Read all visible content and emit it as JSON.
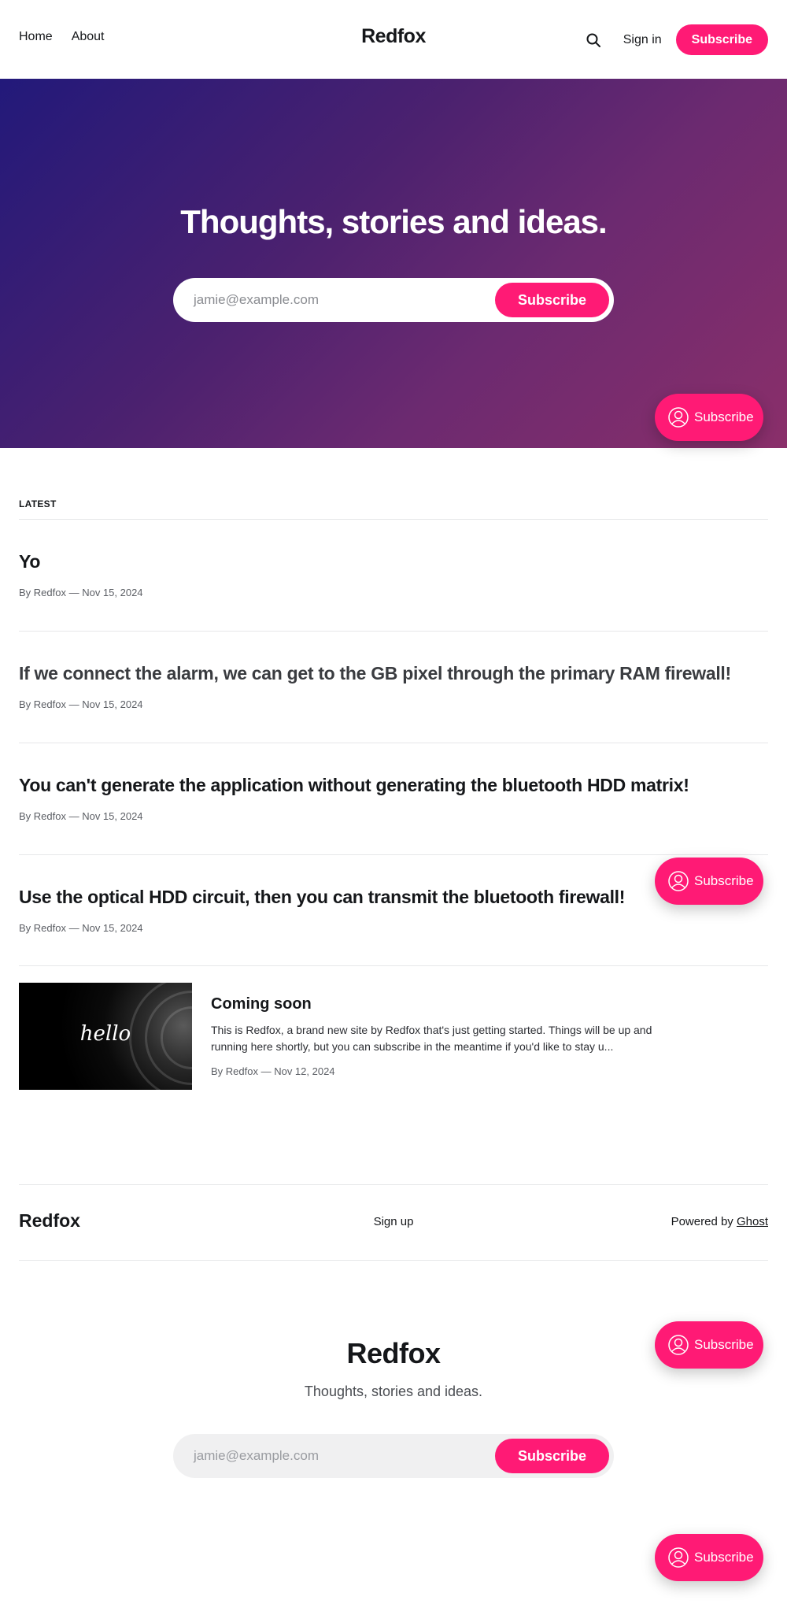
{
  "site": {
    "name": "Redfox",
    "tagline": "Thoughts, stories and ideas."
  },
  "nav": {
    "left": [
      {
        "label": "Home"
      },
      {
        "label": "About"
      }
    ],
    "sign_in": "Sign in",
    "subscribe": "Subscribe",
    "search_icon": "search-icon"
  },
  "hero": {
    "title": "Thoughts, stories and ideas.",
    "email_placeholder": "jamie@example.com",
    "button": "Subscribe"
  },
  "floating_subscribe": {
    "label": "Subscribe",
    "icon": "user-circle-icon"
  },
  "latest": {
    "label": "LATEST",
    "posts": [
      {
        "title": "Yo",
        "meta": "By Redfox — Nov 15, 2024"
      },
      {
        "title": "If we connect the alarm, we can get to the GB pixel through the primary RAM firewall!",
        "meta": "By Redfox — Nov 15, 2024"
      },
      {
        "title": "You can't generate the application without generating the bluetooth HDD matrix!",
        "meta": "By Redfox — Nov 15, 2024"
      },
      {
        "title": "Use the optical HDD circuit, then you can transmit the bluetooth firewall!",
        "meta": "By Redfox — Nov 15, 2024"
      }
    ],
    "featured": {
      "image_text": "hello",
      "title": "Coming soon",
      "excerpt": "This is Redfox, a brand new site by Redfox that's just getting started. Things will be up and running here shortly, but you can subscribe in the meantime if you'd like to stay u...",
      "meta": "By Redfox — Nov 12, 2024"
    }
  },
  "footer": {
    "logo": "Redfox",
    "sign_up": "Sign up",
    "powered_prefix": "Powered by ",
    "powered_link": "Ghost"
  },
  "footer_cta": {
    "title": "Redfox",
    "subtitle": "Thoughts, stories and ideas.",
    "email_placeholder": "jamie@example.com",
    "button": "Subscribe"
  },
  "colors": {
    "accent": "#ff1a75",
    "text": "#15171a"
  }
}
